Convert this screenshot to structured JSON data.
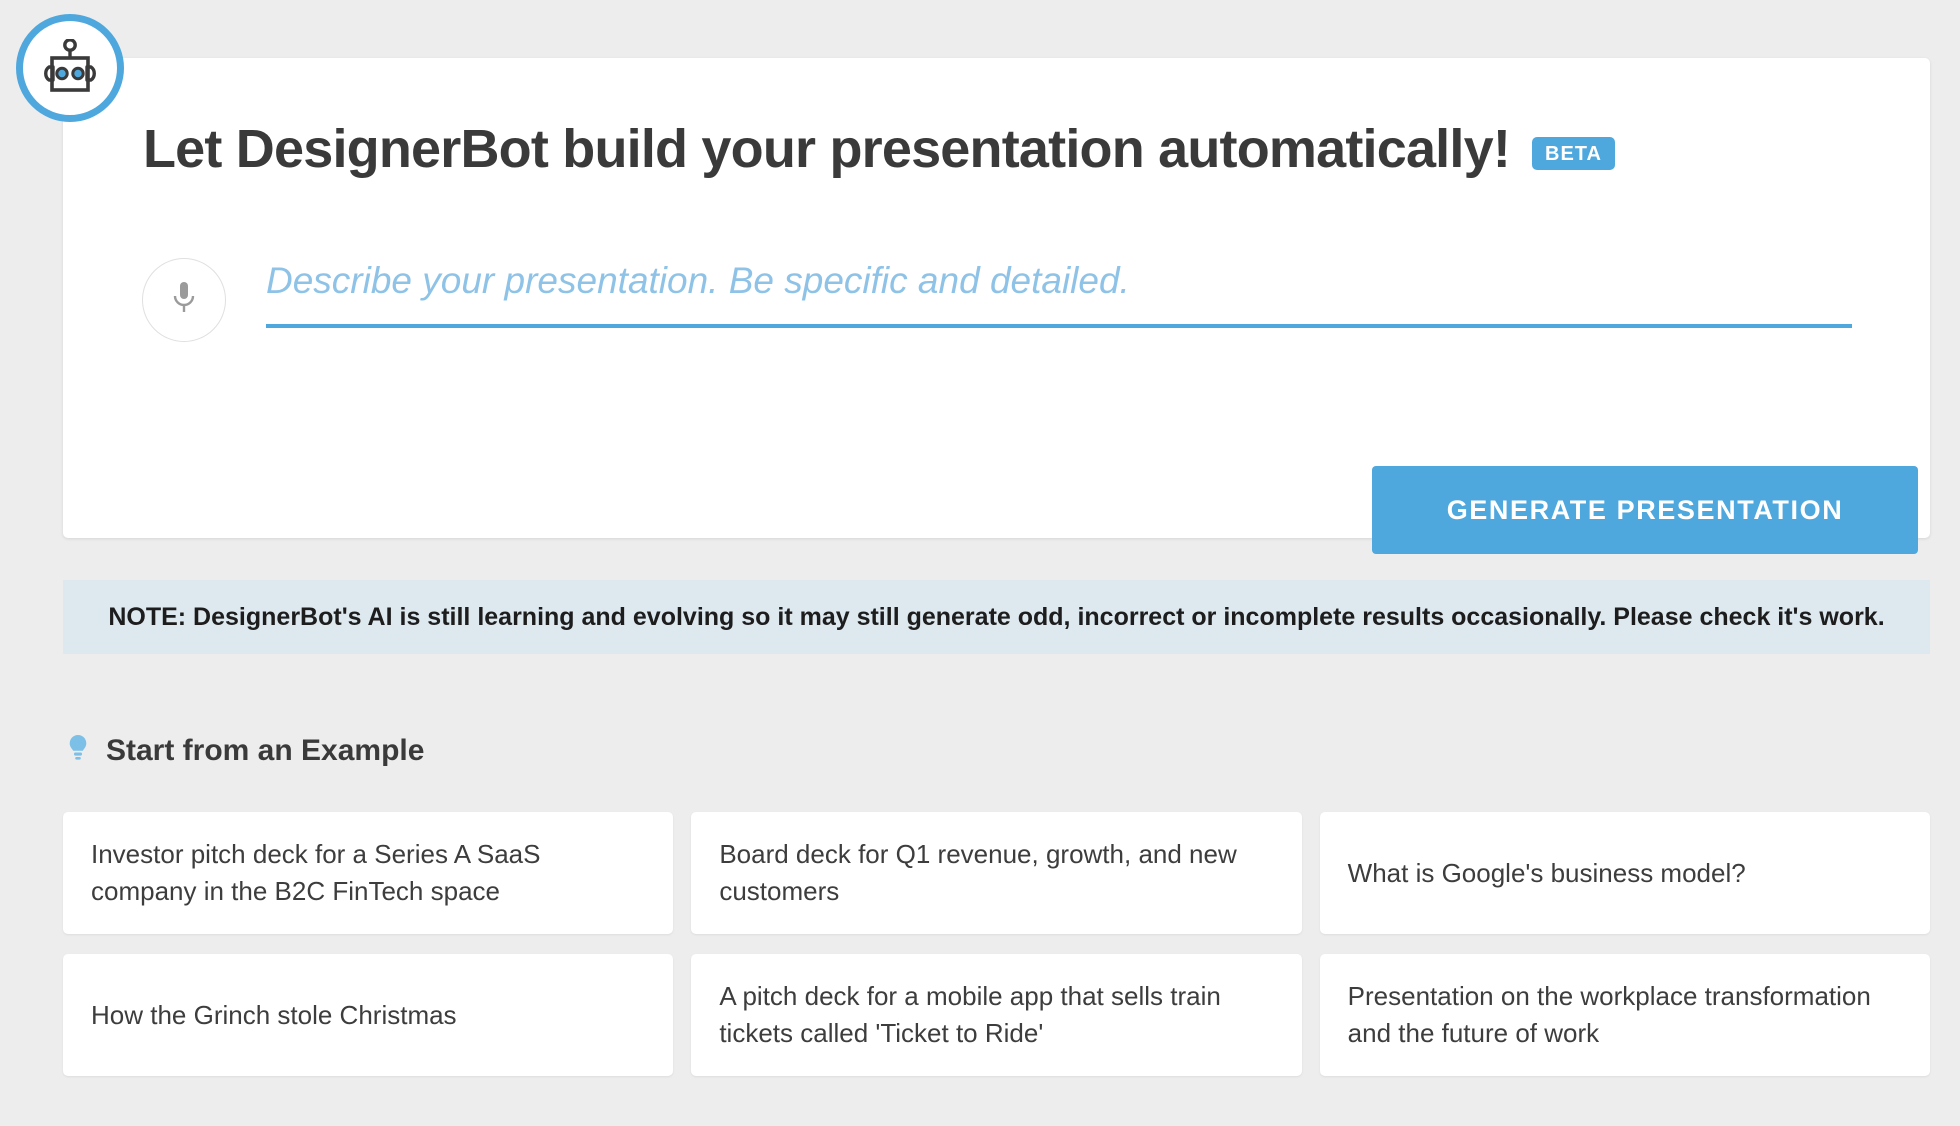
{
  "brand": {
    "logo_icon": "robot-icon",
    "accent_color": "#4ea8dd",
    "page_background": "#ededed"
  },
  "header": {
    "title": "Let DesignerBot build your presentation automatically!",
    "badge": "BETA"
  },
  "prompt": {
    "mic_icon": "microphone-icon",
    "placeholder": "Describe your presentation. Be specific and detailed.",
    "value": "",
    "generate_label": "GENERATE PRESENTATION"
  },
  "note": {
    "text": "NOTE: DesignerBot's AI is still learning and evolving so it may still generate odd, incorrect or incomplete results occasionally. Please check it's work.",
    "background_color": "#dde8ef"
  },
  "examples": {
    "icon": "lightbulb-icon",
    "heading": "Start from an Example",
    "cards": [
      {
        "text": "Investor pitch deck for a Series A SaaS company in the B2C FinTech space"
      },
      {
        "text": "Board deck for Q1 revenue, growth, and new customers"
      },
      {
        "text": "What is Google's business model?"
      },
      {
        "text": "How the Grinch stole Christmas"
      },
      {
        "text": "A pitch deck for a mobile app that sells train tickets called 'Ticket to Ride'"
      },
      {
        "text": "Presentation on the workplace transformation and the future of work"
      }
    ]
  }
}
